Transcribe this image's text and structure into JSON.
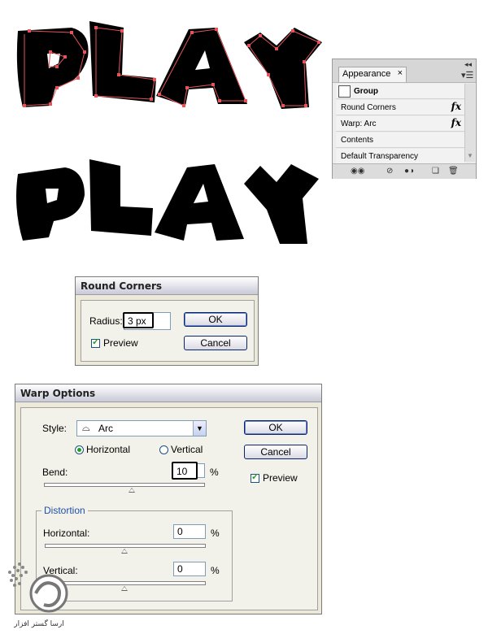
{
  "artwork": {
    "word_top": "PLAY",
    "word_bottom": "PLAY"
  },
  "appearance_panel": {
    "tab_label": "Appearance",
    "close_glyph": "×",
    "rows": [
      {
        "label": "Group",
        "fx": ""
      },
      {
        "label": "Round Corners",
        "fx": "fx"
      },
      {
        "label": "Warp: Arc",
        "fx": "fx"
      },
      {
        "label": "Contents",
        "fx": ""
      },
      {
        "label": "Default Transparency",
        "fx": ""
      }
    ],
    "icons": [
      "new-art-icon",
      "clear-appearance-icon",
      "reduce-appearance-icon",
      "duplicate-item-icon",
      "trash-icon"
    ]
  },
  "round_corners": {
    "title": "Round Corners",
    "radius_label": "Radius:",
    "radius_value": "3 px",
    "preview_label": "Preview",
    "preview_checked": true,
    "ok_label": "OK",
    "cancel_label": "Cancel"
  },
  "warp_options": {
    "title": "Warp Options",
    "style_label": "Style:",
    "style_value": "Arc",
    "horizontal_label": "Horizontal",
    "vertical_label": "Vertical",
    "orientation_selected": "Horizontal",
    "bend_label": "Bend:",
    "bend_value": "10",
    "bend_unit": "%",
    "distortion_label": "Distortion",
    "dist_horizontal_label": "Horizontal:",
    "dist_horizontal_value": "0",
    "dist_vertical_label": "Vertical:",
    "dist_vertical_value": "0",
    "percent": "%",
    "ok_label": "OK",
    "cancel_label": "Cancel",
    "preview_label": "Preview",
    "preview_checked": true
  },
  "watermark": {
    "text": "ارسا گستر افزار"
  }
}
